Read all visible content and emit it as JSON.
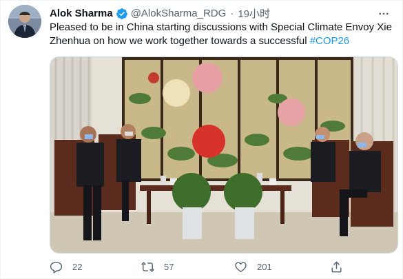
{
  "tweet": {
    "author_name": "Alok Sharma",
    "handle": "@AlokSharma_RDG",
    "separator": "·",
    "time": "19小时",
    "text_main": "Pleased to be in China starting discussions with Special Climate Envoy Xie Zhenhua on how we work together towards a successful ",
    "hashtag": "#COP26"
  },
  "actions": {
    "reply_count": "22",
    "retweet_count": "57",
    "like_count": "201"
  },
  "icons": {
    "verified": "verified-badge-icon",
    "more": "more-options-icon",
    "reply": "reply-icon",
    "retweet": "retweet-icon",
    "like": "heart-icon",
    "share": "share-icon"
  },
  "colors": {
    "accent": "#1d9bf0",
    "secondary_text": "#536471",
    "primary_text": "#0f1419"
  }
}
